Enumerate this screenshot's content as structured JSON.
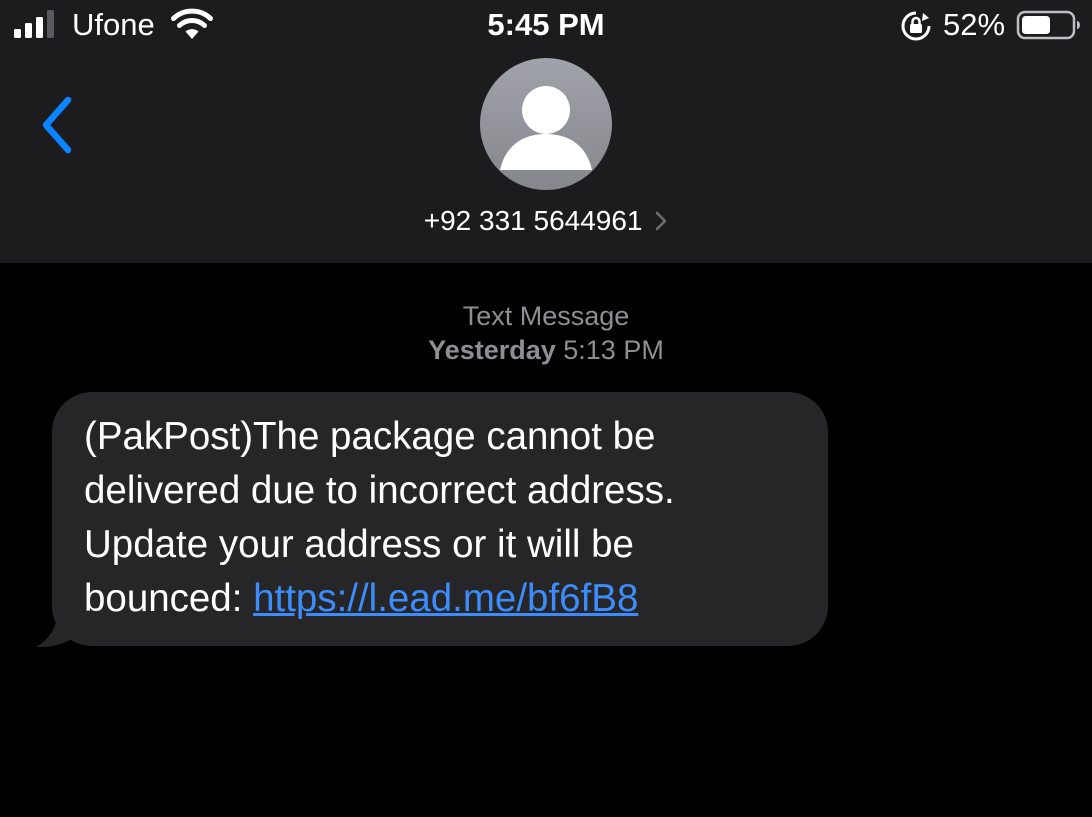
{
  "status_bar": {
    "carrier": "Ufone",
    "time": "5:45 PM",
    "battery": "52%",
    "battery_level": 0.52,
    "signal_bars": 3,
    "icons": [
      "signal-bars-icon",
      "wifi-icon",
      "rotation-lock-icon",
      "battery-icon"
    ]
  },
  "header": {
    "back_icon": "chevron-left-icon",
    "avatar_icon": "person-placeholder-icon",
    "contact": "+92 331 5644961",
    "contact_chevron_icon": "chevron-right-icon"
  },
  "thread": {
    "message_type": "Text Message",
    "day": "Yesterday",
    "time": "5:13 PM",
    "message": {
      "text": "(PakPost)The package cannot be delivered due to incorrect address. Update your address or it will be bounced: ",
      "link": "https://l.ead.me/bf6fB8"
    }
  },
  "colors": {
    "header_bg": "#1c1c1e",
    "background": "#000000",
    "accent": "#0a84ff",
    "bubble": "#262628",
    "link": "#3c8dfb",
    "secondary_text": "#8e8e93"
  }
}
